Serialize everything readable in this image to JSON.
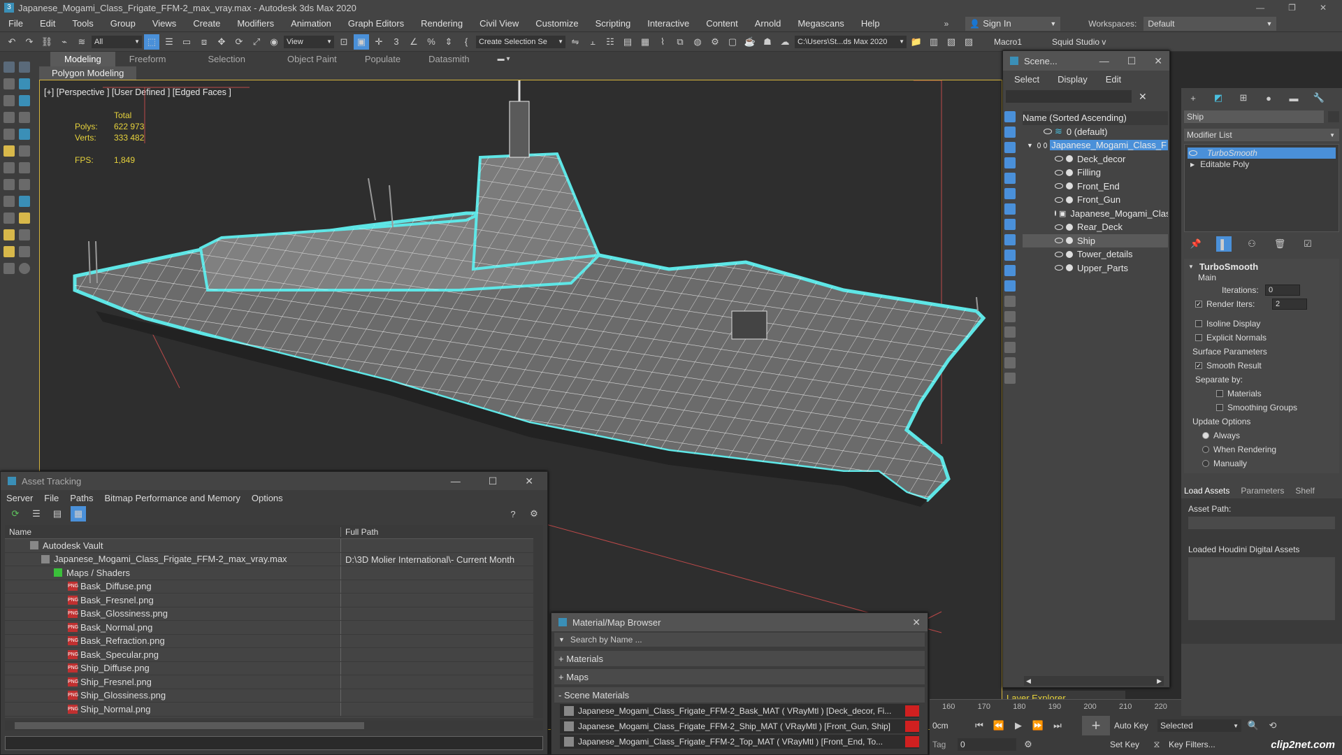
{
  "window": {
    "title": "Japanese_Mogami_Class_Frigate_FFM-2_max_vray.max - Autodesk 3ds Max 2020"
  },
  "menu": [
    "File",
    "Edit",
    "Tools",
    "Group",
    "Views",
    "Create",
    "Modifiers",
    "Animation",
    "Graph Editors",
    "Rendering",
    "Civil View",
    "Customize",
    "Scripting",
    "Interactive",
    "Content",
    "Arnold",
    "Megascans",
    "Help"
  ],
  "account": {
    "sign_in": "Sign In",
    "workspaces_label": "Workspaces:",
    "workspace_value": "Default"
  },
  "toolbar": {
    "filter": "All",
    "ref_coord": "View",
    "selection_set": "Create Selection Se",
    "path": "C:\\Users\\St...ds Max 2020",
    "macro": "Macro1",
    "squid": "Squid Studio v"
  },
  "ribbon": {
    "tabs": [
      "Modeling",
      "Freeform",
      "Selection",
      "Object Paint",
      "Populate",
      "Datasmith"
    ],
    "subtab": "Polygon Modeling"
  },
  "viewport": {
    "label": "[+] [Perspective ] [User Defined ] [Edged Faces ]",
    "stats": {
      "total": "Total",
      "polys_label": "Polys:",
      "polys": "622 973",
      "verts_label": "Verts:",
      "verts": "333 482",
      "fps_label": "FPS:",
      "fps": "1,849"
    }
  },
  "scene_explorer": {
    "title": "Scene...",
    "menu": [
      "Select",
      "Display",
      "Edit"
    ],
    "column": "Name (Sorted Ascending)",
    "items": [
      "0 (default)",
      "Japanese_Mogami_Class_F",
      "Deck_decor",
      "Filling",
      "Front_End",
      "Front_Gun",
      "Japanese_Mogami_Clas",
      "Rear_Deck",
      "Ship",
      "Tower_details",
      "Upper_Parts"
    ],
    "footer": "Layer Explorer"
  },
  "command_panel": {
    "object_name": "Ship",
    "modifier_list": "Modifier List",
    "stack": [
      "TurboSmooth",
      "Editable Poly"
    ],
    "rollout": "TurboSmooth",
    "main": "Main",
    "iterations_label": "Iterations:",
    "iterations": "0",
    "render_iters_label": "Render Iters:",
    "render_iters": "2",
    "isoline": "Isoline Display",
    "explicit": "Explicit Normals",
    "surface_params": "Surface Parameters",
    "smooth_result": "Smooth Result",
    "separate_by": "Separate by:",
    "materials": "Materials",
    "smoothing_groups": "Smoothing Groups",
    "update_options": "Update Options",
    "always": "Always",
    "when_rendering": "When Rendering",
    "manually": "Manually"
  },
  "houdini": {
    "tabs": [
      "Load Assets",
      "Parameters",
      "Shelf"
    ],
    "asset_path": "Asset Path:",
    "loaded": "Loaded Houdini Digital Assets"
  },
  "asset_tracking": {
    "title": "Asset Tracking",
    "menu": [
      "Server",
      "File",
      "Paths",
      "Bitmap Performance and Memory",
      "Options"
    ],
    "columns": [
      "Name",
      "Full Path"
    ],
    "rows": [
      {
        "name": "Autodesk Vault",
        "path": ""
      },
      {
        "name": "Japanese_Mogami_Class_Frigate_FFM-2_max_vray.max",
        "path": "D:\\3D Molier International\\- Current Month"
      },
      {
        "name": "Maps / Shaders",
        "path": ""
      },
      {
        "name": "Bask_Diffuse.png",
        "path": ""
      },
      {
        "name": "Bask_Fresnel.png",
        "path": ""
      },
      {
        "name": "Bask_Glossiness.png",
        "path": ""
      },
      {
        "name": "Bask_Normal.png",
        "path": ""
      },
      {
        "name": "Bask_Refraction.png",
        "path": ""
      },
      {
        "name": "Bask_Specular.png",
        "path": ""
      },
      {
        "name": "Ship_Diffuse.png",
        "path": ""
      },
      {
        "name": "Ship_Fresnel.png",
        "path": ""
      },
      {
        "name": "Ship_Glossiness.png",
        "path": ""
      },
      {
        "name": "Ship_Normal.png",
        "path": ""
      }
    ]
  },
  "material_browser": {
    "title": "Material/Map Browser",
    "search": "Search by Name ...",
    "groups": [
      "+ Materials",
      "+ Maps",
      "- Scene Materials"
    ],
    "materials": [
      "Japanese_Mogami_Class_Frigate_FFM-2_Bask_MAT ( VRayMtl ) [Deck_decor, Fi...",
      "Japanese_Mogami_Class_Frigate_FFM-2_Ship_MAT ( VRayMtl ) [Front_Gun, Ship]",
      "Japanese_Mogami_Class_Frigate_FFM-2_Top_MAT ( VRayMtl ) [Front_End, To..."
    ]
  },
  "timeline": {
    "ticks": [
      "160",
      "170",
      "180",
      "190",
      "200",
      "210",
      "220"
    ],
    "time": "0cm",
    "frame": "0",
    "auto_key": "Auto Key",
    "selected": "Selected",
    "set_key": "Set Key",
    "key_filters": "Key Filters...",
    "tag": "Tag"
  },
  "watermark": "clip2net.com",
  "colors": {
    "accent": "#4a90d9",
    "wire": "#5ee6e6",
    "stats": "#e6d23c",
    "viewport_border": "#d6b53d"
  }
}
